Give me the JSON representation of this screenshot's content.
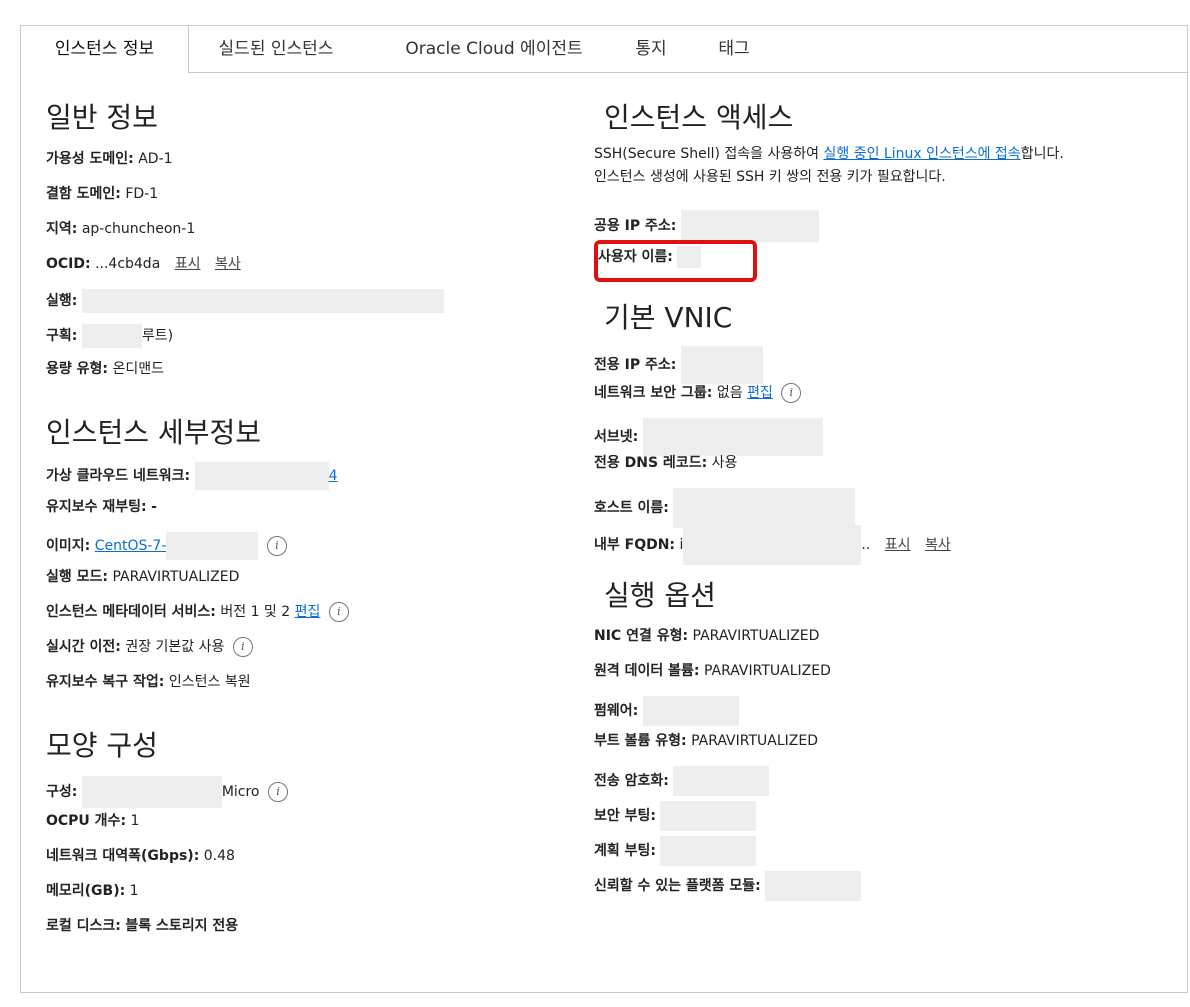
{
  "tabs": [
    {
      "label": "인스턴스 정보"
    },
    {
      "label": "실드된 인스턴스"
    },
    {
      "label": "Oracle Cloud 에이전트"
    },
    {
      "label": "통지"
    },
    {
      "label": "태그"
    }
  ],
  "general": {
    "title": "일반 정보",
    "ad_label": "가용성 도메인:",
    "ad_value": "AD-1",
    "fd_label": "결함 도메인:",
    "fd_value": "FD-1",
    "region_label": "지역:",
    "region_value": "ap-chuncheon-1",
    "ocid_label": "OCID:",
    "ocid_value": "...4cb4da",
    "ocid_show": "표시",
    "ocid_copy": "복사",
    "launched_label": "실행:",
    "compartment_label": "구획:",
    "compartment_suffix": "루트)",
    "capacity_label": "용량 유형:",
    "capacity_value": "온디맨드"
  },
  "details": {
    "title": "인스턴스 세부정보",
    "vcn_label": "가상 클라우드 네트워크:",
    "vcn_suffix": "4",
    "maint_reboot_label": "유지보수 재부팅:",
    "maint_reboot_value": "-",
    "image_label": "이미지:",
    "image_value": "CentOS-7-",
    "launch_mode_label": "실행 모드:",
    "launch_mode_value": "PARAVIRTUALIZED",
    "metadata_label": "인스턴스 메타데이터 서비스:",
    "metadata_value": "버전 1 및 2",
    "metadata_edit": "편집",
    "live_migration_label": "실시간 이전:",
    "live_migration_value": "권장 기본값 사용",
    "maint_recovery_label": "유지보수 복구 작업:",
    "maint_recovery_value": "인스턴스 복원"
  },
  "shape": {
    "title": "모양 구성",
    "shape_label": "구성:",
    "shape_suffix": "Micro",
    "ocpu_label": "OCPU 개수:",
    "ocpu_value": "1",
    "bandwidth_label": "네트워크 대역폭(Gbps):",
    "bandwidth_value": "0.48",
    "memory_label": "메모리(GB):",
    "memory_value": "1",
    "disk_label": "로컬 디스크:",
    "disk_value": "블록 스토리지 전용"
  },
  "access": {
    "title": "인스턴스 액세스",
    "desc_pre": "SSH(Secure Shell) 접속을 사용하여 ",
    "desc_link": "실행 중인 Linux 인스턴스에 접속",
    "desc_post": "합니다.",
    "desc_line2": "인스턴스 생성에 사용된 SSH 키 쌍의 전용 키가 필요합니다.",
    "public_ip_label": "공용 IP 주소:",
    "username_label": "사용자 이름:"
  },
  "vnic": {
    "title": "기본 VNIC",
    "private_ip_label": "전용 IP 주소:",
    "nsg_label": "네트워크 보안 그룹:",
    "nsg_value": "없음",
    "nsg_edit": "편집",
    "subnet_label": "서브넷:",
    "dns_label": "전용 DNS 레코드:",
    "dns_value": "사용",
    "hostname_label": "호스트 이름:",
    "fqdn_label": "내부 FQDN:",
    "fqdn_prefix": "i",
    "fqdn_suffix": "..",
    "fqdn_show": "표시",
    "fqdn_copy": "복사"
  },
  "launch": {
    "title": "실행 옵션",
    "nic_label": "NIC 연결 유형:",
    "nic_value": "PARAVIRTUALIZED",
    "remote_vol_label": "원격 데이터 볼륨:",
    "remote_vol_value": "PARAVIRTUALIZED",
    "firmware_label": "펌웨어:",
    "boot_vol_label": "부트 볼륨 유형:",
    "boot_vol_value": "PARAVIRTUALIZED",
    "transit_label": "전송 암호화:",
    "secure_boot_label": "보안 부팅:",
    "measured_boot_label": "계획 부팅:",
    "tpm_label": "신뢰할 수 있는 플랫폼 모듈:"
  },
  "colors": {
    "accent": "#0a6ed1",
    "highlight": "#e01010",
    "mask": "#eeeeee"
  }
}
